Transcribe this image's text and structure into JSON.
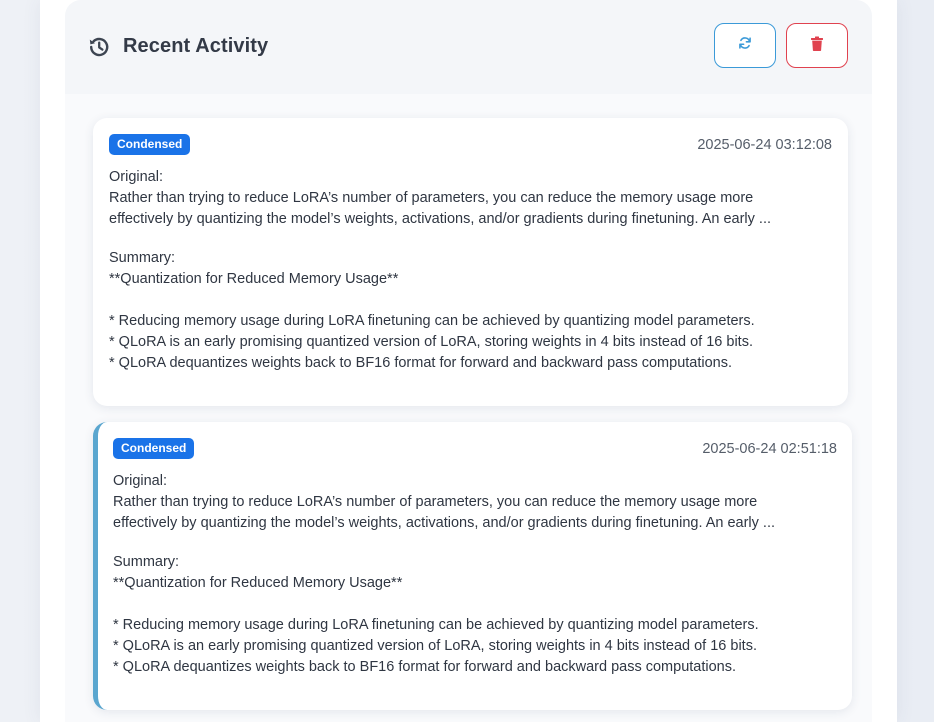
{
  "header": {
    "title": "Recent Activity",
    "refresh_icon": "refresh-icon",
    "delete_icon": "trash-icon",
    "history_icon": "history-icon"
  },
  "colors": {
    "accent_blue": "#1a73e8",
    "refresh_border": "#3b9ad8",
    "delete_border": "#e0424f",
    "active_card_border": "#5aa6cf"
  },
  "activities": [
    {
      "badge": "Condensed",
      "timestamp": "2025-06-24 03:12:08",
      "original_label": "Original:",
      "original_line1": "Rather than trying to reduce LoRA’s number of parameters, you can reduce the memory usage more",
      "original_line2": "effectively by quantizing the model’s weights, activations, and/or gradients during finetuning. An early ...",
      "summary_label": "Summary:",
      "summary_heading": "**Quantization for Reduced Memory Usage**",
      "bullet1": "* Reducing memory usage during LoRA finetuning can be achieved by quantizing model parameters.",
      "bullet2": "* QLoRA is an early promising quantized version of LoRA, storing weights in 4 bits instead of 16 bits.",
      "bullet3": "* QLoRA dequantizes weights back to BF16 format for forward and backward pass computations."
    },
    {
      "badge": "Condensed",
      "timestamp": "2025-06-24 02:51:18",
      "original_label": "Original:",
      "original_line1": "Rather than trying to reduce LoRA’s number of parameters, you can reduce the memory usage more",
      "original_line2": "effectively by quantizing the model’s weights, activations, and/or gradients during finetuning. An early ...",
      "summary_label": "Summary:",
      "summary_heading": "**Quantization for Reduced Memory Usage**",
      "bullet1": "* Reducing memory usage during LoRA finetuning can be achieved by quantizing model parameters.",
      "bullet2": "* QLoRA is an early promising quantized version of LoRA, storing weights in 4 bits instead of 16 bits.",
      "bullet3": "* QLoRA dequantizes weights back to BF16 format for forward and backward pass computations."
    }
  ]
}
